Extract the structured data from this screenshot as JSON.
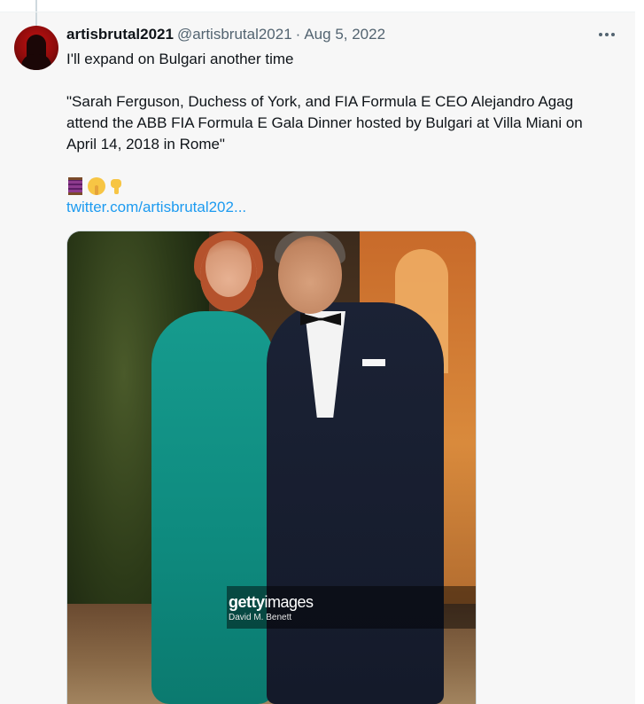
{
  "tweet": {
    "author_name": "artisbrutal2021",
    "handle": "@artisbrutal2021",
    "separator": "·",
    "date": "Aug 5, 2022",
    "line1": "I'll expand on Bulgari another time",
    "quote": "\"Sarah Ferguson, Duchess of York, and FIA Formula E CEO Alejandro Agag attend the ABB FIA Formula E Gala Dinner hosted by Bulgari at Villa Miani on April 14, 2018 in Rome\"",
    "emojis": [
      "thread-spool-emoji",
      "shushing-face-emoji",
      "backhand-index-pointing-down-emoji"
    ],
    "link": "twitter.com/artisbrutal202..."
  },
  "media": {
    "watermark_brand_bold": "getty",
    "watermark_brand_light": "images",
    "watermark_credit": "David M. Benett"
  },
  "icons": {
    "more": "more-horizontal-icon"
  },
  "colors": {
    "link": "#1d9bf0",
    "muted": "#536471",
    "background": "#f7f7f7"
  }
}
